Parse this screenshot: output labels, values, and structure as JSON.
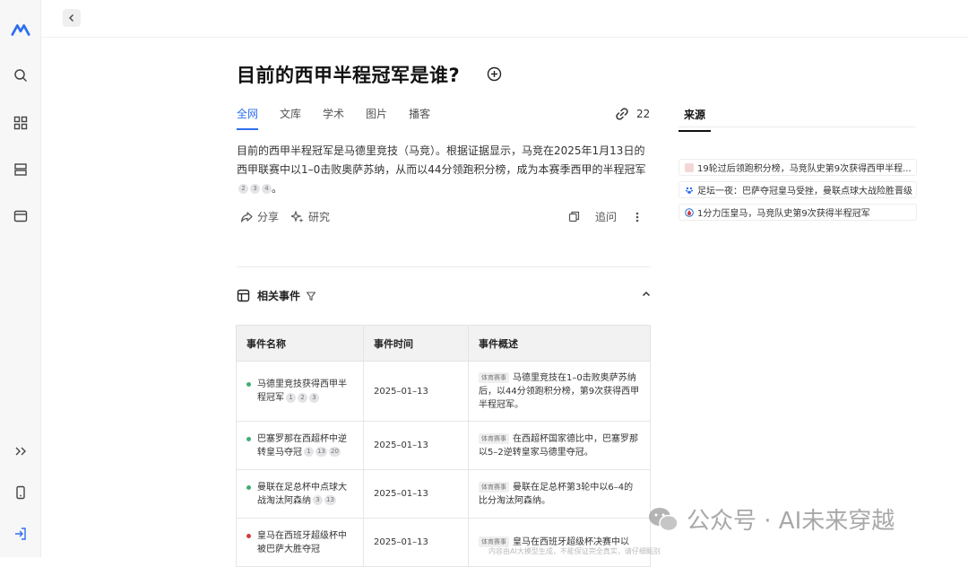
{
  "rail": {
    "icons": [
      "logo-icon",
      "search-icon",
      "apps-grid-icon",
      "layers-icon",
      "window-icon",
      "expand-icon",
      "mobile-icon",
      "login-icon"
    ]
  },
  "question": {
    "title": "目前的西甲半程冠军是谁?"
  },
  "tabs": [
    {
      "label": "全网",
      "active": true
    },
    {
      "label": "文库",
      "active": false
    },
    {
      "label": "学术",
      "active": false
    },
    {
      "label": "图片",
      "active": false
    },
    {
      "label": "播客",
      "active": false
    }
  ],
  "link_count": "22",
  "answer": {
    "text": "目前的西甲半程冠军是马德里竞技（马竞）。根据证据显示，马竞在2025年1月13日的西甲联赛中以1–0击败奥萨苏纳，从而以44分领跑积分榜，成为本赛季西甲的半程冠军",
    "citations": [
      "2",
      "3",
      "4"
    ],
    "end": "。"
  },
  "actions": {
    "share": "分享",
    "research": "研究",
    "followup": "追问"
  },
  "events": {
    "heading": "相关事件",
    "columns": [
      "事件名称",
      "事件时间",
      "事件概述"
    ],
    "rows": [
      {
        "name": "马德里竞技获得西甲半程冠军",
        "cites": [
          "1",
          "2",
          "3"
        ],
        "date": "2025–01–13",
        "tag": "体育赛事",
        "summary": "马德里竞技在1–0击败奥萨苏纳后，以44分领跑积分榜，第9次获得西甲半程冠军。",
        "dot": "#3fae75"
      },
      {
        "name": "巴塞罗那在西超杯中逆转皇马夺冠",
        "cites": [
          "1",
          "13",
          "20"
        ],
        "date": "2025–01–13",
        "tag": "体育赛事",
        "summary": "在西超杯国家德比中，巴塞罗那以5–2逆转皇家马德里夺冠。",
        "dot": "#3fae75"
      },
      {
        "name": "曼联在足总杯中点球大战淘汰阿森纳",
        "cites": [
          "3",
          "13"
        ],
        "date": "2025–01–13",
        "tag": "体育赛事",
        "summary": "曼联在足总杯第3轮中以6–4的比分淘汰阿森纳。",
        "dot": "#3fae75"
      },
      {
        "name": "皇马在西班牙超级杯中被巴萨大胜夺冠",
        "cites": [],
        "date": "2025–01–13",
        "tag": "体育赛事",
        "summary": "皇马在西班牙超级杯决赛中以",
        "dot": "#d23b3b"
      }
    ]
  },
  "sources": {
    "title": "来源",
    "items": [
      {
        "label": "19轮过后领跑积分榜，马竞队史第9次获得西甲半程...",
        "color": "#d9534f"
      },
      {
        "label": "足坛一夜：巴萨夺冠皇马受挫，曼联点球大战险胜晋级",
        "color": "#2e6ff0"
      },
      {
        "label": "1分力压皇马，马竞队史第9次获得半程冠军",
        "color": "#1a6fd8"
      }
    ]
  },
  "watermark": "公众号 · AI未来穿越",
  "disclaimer": "内容由AI大模型生成，不能保证完全真实，请仔细甄别"
}
